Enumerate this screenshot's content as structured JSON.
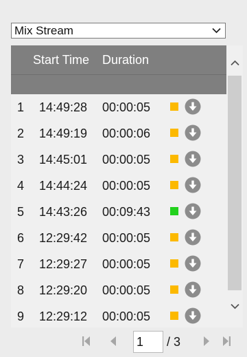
{
  "stream_select": {
    "selected": "Mix Stream"
  },
  "table": {
    "headers": {
      "start_time": "Start Time",
      "duration": "Duration"
    },
    "rows": [
      {
        "index": "1",
        "start": "14:49:28",
        "duration": "00:00:05",
        "status_color": "#fcb900"
      },
      {
        "index": "2",
        "start": "14:49:19",
        "duration": "00:00:06",
        "status_color": "#fcb900"
      },
      {
        "index": "3",
        "start": "14:45:01",
        "duration": "00:00:05",
        "status_color": "#fcb900"
      },
      {
        "index": "4",
        "start": "14:44:24",
        "duration": "00:00:05",
        "status_color": "#fcb900"
      },
      {
        "index": "5",
        "start": "14:43:26",
        "duration": "00:09:43",
        "status_color": "#22d11d"
      },
      {
        "index": "6",
        "start": "12:29:42",
        "duration": "00:00:05",
        "status_color": "#fcb900"
      },
      {
        "index": "7",
        "start": "12:29:27",
        "duration": "00:00:05",
        "status_color": "#fcb900"
      },
      {
        "index": "8",
        "start": "12:29:20",
        "duration": "00:00:05",
        "status_color": "#fcb900"
      },
      {
        "index": "9",
        "start": "12:29:12",
        "duration": "00:00:05",
        "status_color": "#fcb900"
      }
    ]
  },
  "pager": {
    "current_page": "1",
    "total_label": "/ 3"
  },
  "colors": {
    "header_bg": "#7f7f7f",
    "download_icon": "#8c8c8c",
    "pager_icon": "#a6a6a6"
  },
  "icons": {
    "select": "chevron-down-icon",
    "row_action": "download-icon",
    "scroll_up": "chevron-up-icon",
    "scroll_down": "chevron-down-icon",
    "pager": [
      "first-page-icon",
      "prev-page-icon",
      "next-page-icon",
      "last-page-icon"
    ]
  }
}
